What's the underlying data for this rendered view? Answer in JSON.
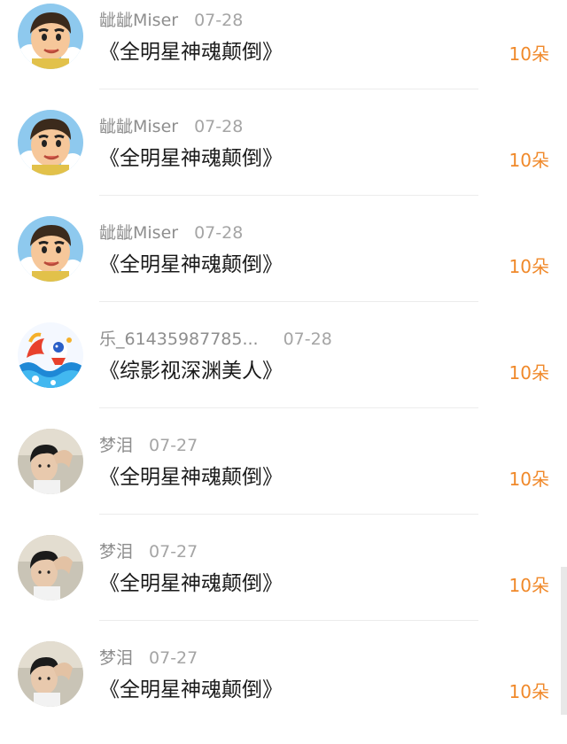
{
  "icons": {
    "cartoon": "cartoon-boy-avatar-icon",
    "dragon": "colorful-dragon-avatar-icon",
    "photo": "young-man-photo-avatar-icon"
  },
  "colors": {
    "amount": "#f0892a",
    "meta": "#8e8e8e",
    "title": "#1a1a1a"
  },
  "records": [
    {
      "user": "龇龇Miser",
      "date": "07-28",
      "title": "《全明星神魂颠倒》",
      "amount": "10朵",
      "avatar": "cartoon"
    },
    {
      "user": "龇龇Miser",
      "date": "07-28",
      "title": "《全明星神魂颠倒》",
      "amount": "10朵",
      "avatar": "cartoon"
    },
    {
      "user": "龇龇Miser",
      "date": "07-28",
      "title": "《全明星神魂颠倒》",
      "amount": "10朵",
      "avatar": "cartoon"
    },
    {
      "user": "乐_61435987785...",
      "date": "07-28",
      "title": "《综影视深渊美人》",
      "amount": "10朵",
      "avatar": "dragon"
    },
    {
      "user": "梦泪",
      "date": "07-27",
      "title": "《全明星神魂颠倒》",
      "amount": "10朵",
      "avatar": "photo"
    },
    {
      "user": "梦泪",
      "date": "07-27",
      "title": "《全明星神魂颠倒》",
      "amount": "10朵",
      "avatar": "photo"
    },
    {
      "user": "梦泪",
      "date": "07-27",
      "title": "《全明星神魂颠倒》",
      "amount": "10朵",
      "avatar": "photo"
    }
  ]
}
